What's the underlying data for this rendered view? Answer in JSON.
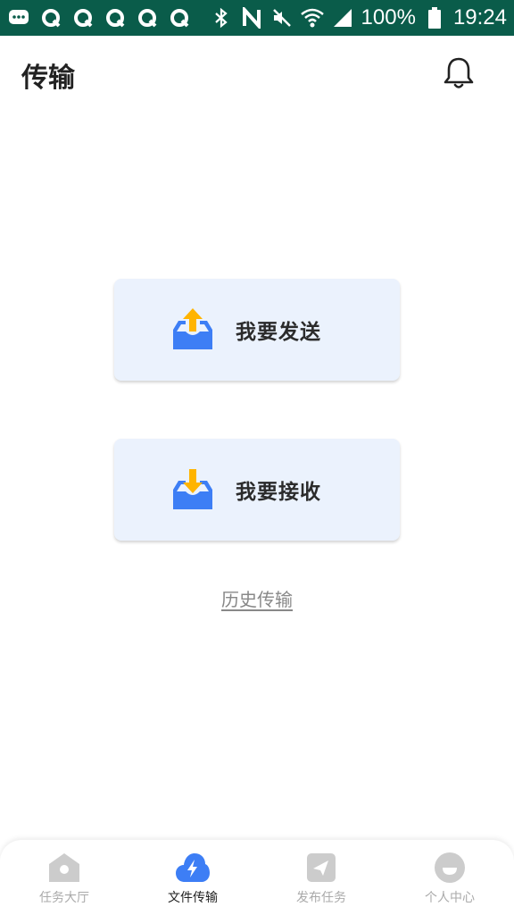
{
  "status_bar": {
    "battery": "100%",
    "time": "19:24",
    "left_icons": [
      "chat-icon",
      "q-app-icon",
      "q-app-icon",
      "q-app-icon",
      "q-app-icon",
      "q-app-icon"
    ],
    "right_icons": [
      "bluetooth-icon",
      "nfc-icon",
      "mute-icon",
      "wifi-icon",
      "signal-icon",
      "battery-icon"
    ]
  },
  "header": {
    "title": "传输",
    "bell_icon": "bell-icon"
  },
  "actions": {
    "send_label": "我要发送",
    "receive_label": "我要接收",
    "history_label": "历史传输"
  },
  "bottom_nav": {
    "items": [
      {
        "label": "任务大厅",
        "icon": "home-icon",
        "active": false
      },
      {
        "label": "文件传输",
        "icon": "transfer-icon",
        "active": true
      },
      {
        "label": "发布任务",
        "icon": "publish-icon",
        "active": false
      },
      {
        "label": "个人中心",
        "icon": "profile-icon",
        "active": false
      }
    ]
  },
  "colors": {
    "status_bar": "#0a5c4a",
    "card_bg": "#ebf2fd",
    "accent_blue": "#3d7ef5",
    "arrow_yellow": "#ffb400",
    "nav_inactive": "#cccccc"
  }
}
